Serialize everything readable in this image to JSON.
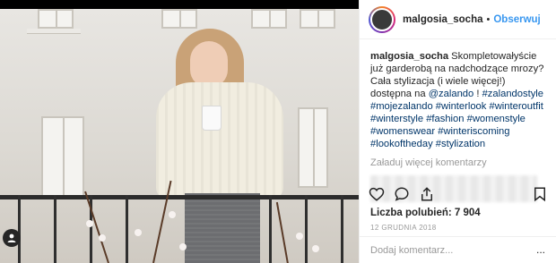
{
  "post": {
    "username": "malgosia_socha",
    "follow_label": "Obserwuj",
    "separator": "•",
    "caption_user": "malgosia_socha",
    "caption_text": " Skompletowałyście już garderobą na nadchodzące mrozy? Cała stylizacja (i wiele więcej!) dostępna na ",
    "caption_mention": "@zalando",
    "caption_after_mention": " ! ",
    "hashtags": [
      "#zalandostyle",
      "#mojezalando",
      "#winterlook",
      "#winteroutfit",
      "#winterstyle",
      "#fashion",
      "#womenstyle",
      "#womenswear",
      "#winteriscoming",
      "#lookoftheday",
      "#stylization"
    ],
    "load_more_comments": "Załaduj więcej komentarzy",
    "likes": "Liczba polubień: 7 904",
    "date": "12 GRUDNIA 2018",
    "add_comment_placeholder": "Dodaj komentarz...",
    "more_options": "..."
  },
  "icons": {
    "like": "heart-icon",
    "comment": "comment-icon",
    "share": "share-icon",
    "save": "bookmark-icon",
    "tagged": "user-tag-icon"
  },
  "colors": {
    "link": "#3897f0",
    "hashtag": "#003569",
    "muted": "#999999",
    "text": "#262626"
  }
}
